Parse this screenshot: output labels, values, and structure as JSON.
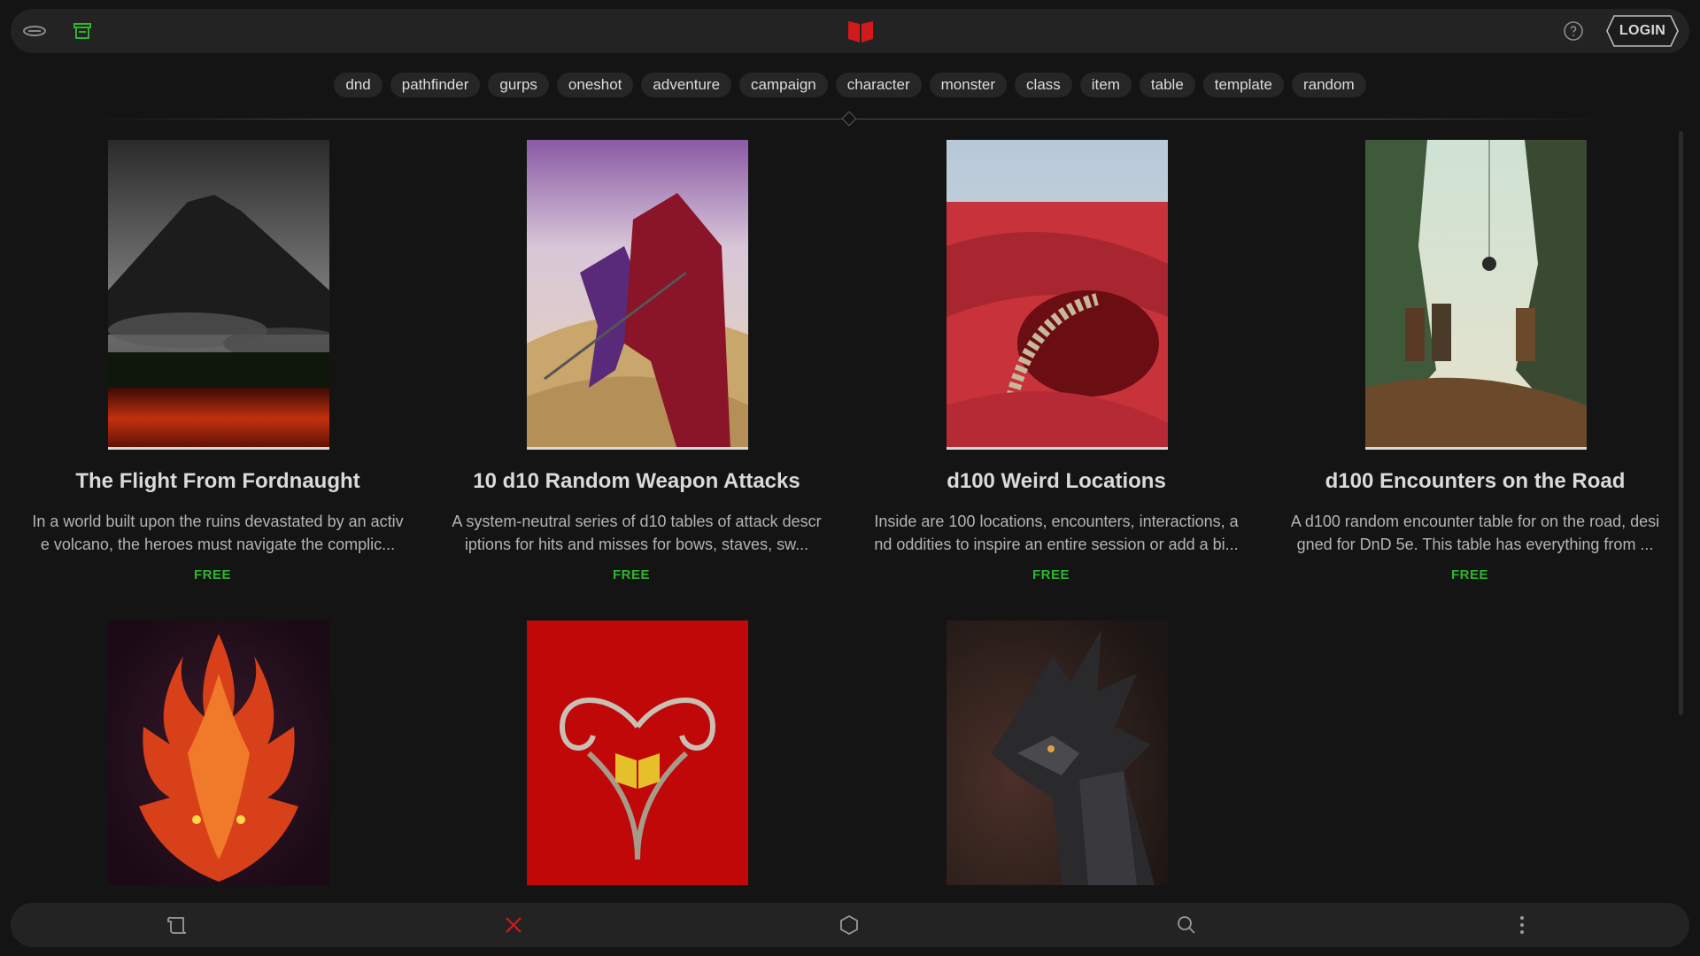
{
  "header": {
    "left_icons": [
      "menu-icon",
      "store-icon"
    ],
    "logo": "red-book-icon",
    "help_icon": "help-icon",
    "login_label": "LOGIN"
  },
  "tags": [
    "dnd",
    "pathfinder",
    "gurps",
    "oneshot",
    "adventure",
    "campaign",
    "character",
    "monster",
    "class",
    "item",
    "table",
    "template",
    "random"
  ],
  "cards": [
    {
      "title": "The Flight From Fordnaught",
      "description": "In a world built upon the ruins devastated by an active volcano, the heroes must navigate the complic...",
      "price": "FREE"
    },
    {
      "title": "10 d10 Random Weapon Attacks",
      "description": "A system-neutral series of d10 tables of attack descriptions for hits and misses for bows, staves, sw...",
      "price": "FREE"
    },
    {
      "title": "d100 Weird Locations",
      "description": "Inside are 100 locations, encounters, interactions, and oddities to inspire an entire session or add a bi...",
      "price": "FREE"
    },
    {
      "title": "d100 Encounters on the Road",
      "description": "A d100 random encounter table for on the road, designed for DnD 5e. This table has everything from ...",
      "price": "FREE"
    }
  ],
  "bottom_nav": [
    "scroll-icon",
    "close-icon",
    "hexagon-icon",
    "search-icon",
    "more-vertical-icon"
  ],
  "colors": {
    "background": "#141414",
    "bar": "#232323",
    "accent_red": "#d11a1a",
    "price_green": "#2db52d"
  }
}
